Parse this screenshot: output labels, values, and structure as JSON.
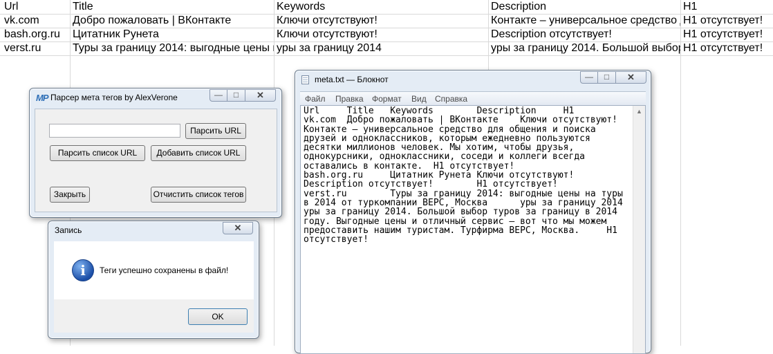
{
  "spreadsheet": {
    "headers": [
      "Url",
      "Title",
      "Keywords",
      "Description",
      "H1"
    ],
    "rows": [
      [
        "vk.com",
        "Добро пожаловать | ВКонтакте",
        "Ключи отсутствуют!",
        "Контакте – универсальное средство д",
        "H1 отсутствует!"
      ],
      [
        "bash.org.ru",
        "Цитатник Рунета",
        "Ключи отсутствуют!",
        "Description отсутствует!",
        "H1 отсутствует!"
      ],
      [
        "verst.ru",
        "Туры за границу 2014: выгодные цены н",
        "уры за границу 2014",
        "уры за границу 2014. Большой выбор",
        "H1 отсутствует!"
      ]
    ]
  },
  "parser_window": {
    "logo": "MP",
    "title": "Парсер мета тегов by AlexVerone",
    "url_input_value": "",
    "parse_url_label": "Парсить URL",
    "parse_list_label": "Парсить список URL",
    "add_list_label": "Добавить список URL",
    "close_label": "Закрыть",
    "clear_tags_label": "Отчистить список тегов",
    "min_glyph": "—",
    "max_glyph": "□",
    "close_glyph": "✕"
  },
  "save_dialog": {
    "title": "Запись",
    "message": "Теги успешно сохранены в файл!",
    "ok_label": "OK",
    "icon_glyph": "i",
    "close_glyph": "✕"
  },
  "notepad": {
    "title": "meta.txt — Блокнот",
    "menu": [
      "Файл",
      "Правка",
      "Формат",
      "Вид",
      "Справка"
    ],
    "content": "Url     Title   Keywords        Description     H1\nvk.com  Добро пожаловать | ВКонтакте    Ключи отсутствуют!\nКонтакте – универсальное средство для общения и поиска\nдрузей и одноклассников, которым ежедневно пользуются\nдесятки миллионов человек. Мы хотим, чтобы друзья,\nоднокурсники, одноклассники, соседи и коллеги всегда\nоставались в контакте.  H1 отсутствует!\nbash.org.ru     Цитатник Рунета Ключи отсутствуют!\nDescription отсутствует!        H1 отсутствует!\nverst.ru        Туры за границу 2014: выгодные цены на туры\nв 2014 от туркомпании ВЕРС, Москва      уры за границу 2014\nуры за границу 2014. Большой выбор туров за границу в 2014\nгоду. Выгодные цены и отличный сервис – вот что мы можем\nпредоставить нашим туристам. Турфирма ВЕРС, Москва.     H1\nотсутствует!",
    "min_glyph": "—",
    "max_glyph": "□",
    "close_glyph": "✕",
    "scroll_up_glyph": "▲"
  }
}
